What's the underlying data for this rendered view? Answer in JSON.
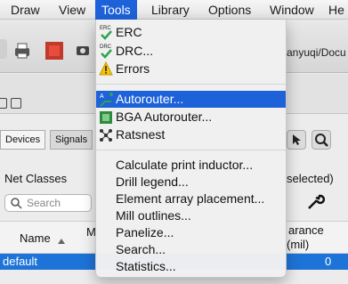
{
  "menubar": {
    "items": [
      "Draw",
      "View",
      "Tools",
      "Library",
      "Options",
      "Window",
      "He"
    ]
  },
  "window": {
    "path_fragment": "anyuqi/Docu",
    "panel_tabs": [
      "Devices",
      "Signals"
    ],
    "net_classes_label": "Net Classes",
    "selected_fragment": "selected)",
    "search_placeholder": "Search",
    "columns": {
      "name": "Name",
      "m": "M",
      "clearance_top": "arance",
      "clearance_unit": "(mil)"
    },
    "row": {
      "name": "default",
      "value": "0"
    }
  },
  "tools_menu": {
    "group1": [
      {
        "label": "ERC",
        "icon": "erc-check-icon"
      },
      {
        "label": "DRC...",
        "icon": "drc-check-icon"
      },
      {
        "label": "Errors",
        "icon": "warning-icon"
      }
    ],
    "group2": [
      {
        "label": "Autorouter...",
        "icon": "autorouter-icon",
        "highlighted": true
      },
      {
        "label": "BGA Autorouter...",
        "icon": "bga-chip-icon"
      },
      {
        "label": "Ratsnest",
        "icon": "ratsnest-icon"
      }
    ],
    "group3": [
      "Calculate print inductor...",
      "Drill legend...",
      "Element array placement...",
      "Mill outlines...",
      "Panelize...",
      "Search...",
      "Statistics..."
    ]
  },
  "colors": {
    "menu_highlight": "#1d62d9",
    "check_green": "#2ea44f",
    "warning_yellow": "#f5c400",
    "selection_row": "#1e73d8"
  }
}
